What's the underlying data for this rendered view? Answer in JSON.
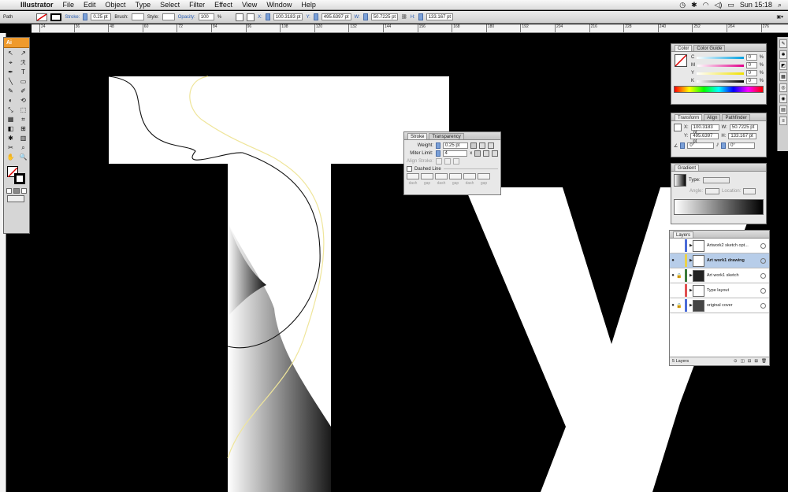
{
  "menubar": {
    "app": "Illustrator",
    "menus": [
      "File",
      "Edit",
      "Object",
      "Type",
      "Select",
      "Filter",
      "Effect",
      "View",
      "Window",
      "Help"
    ],
    "clock": "Sun 15:18"
  },
  "controlbar": {
    "selection_type": "Path",
    "stroke_label": "Stroke:",
    "stroke_value": "0.25 pt",
    "brush_label": "Brush:",
    "style_label": "Style:",
    "opacity_label": "Opacity:",
    "opacity_value": "100",
    "opacity_unit": "%",
    "x_label": "X:",
    "x_value": "100.3183 pt",
    "y_label": "Y:",
    "y_value": "495.6397 pt",
    "w_label": "W:",
    "w_value": "50.7225 pt",
    "h_label": "H:",
    "h_value": "133.167 pt"
  },
  "ruler": [
    "24",
    "36",
    "48",
    "60",
    "72",
    "84",
    "96",
    "108",
    "120",
    "132",
    "144",
    "156",
    "168",
    "180",
    "192",
    "204",
    "216",
    "228",
    "240",
    "252",
    "264",
    "276"
  ],
  "tools_panel": {
    "badge": "Ai",
    "tools": [
      "↖",
      "↗",
      "⌖",
      "ℛ",
      "✒",
      "T",
      "╲",
      "▭",
      "✎",
      "✐",
      "◐",
      "⟲",
      "⤡",
      "⬚",
      "▦",
      "⌗",
      "◧",
      "⊞",
      "✱",
      "▥",
      "✂",
      "⌕",
      "✋",
      "🔍"
    ]
  },
  "color_panel": {
    "tabs": [
      "Color",
      "Color Guide"
    ],
    "channels": [
      {
        "label": "C",
        "value": "0",
        "unit": "%"
      },
      {
        "label": "M",
        "value": "0",
        "unit": "%"
      },
      {
        "label": "Y",
        "value": "0",
        "unit": "%"
      },
      {
        "label": "K",
        "value": "0",
        "unit": "%"
      }
    ]
  },
  "transform_panel": {
    "tabs": [
      "Transform",
      "Align",
      "Pathfinder"
    ],
    "x_label": "X:",
    "x_value": "100.3183 pt",
    "y_label": "Y:",
    "y_value": "495.6397 pt",
    "w_label": "W:",
    "w_value": "50.7225 pt",
    "h_label": "H:",
    "h_value": "133.167 pt",
    "rotate_value": "0°",
    "shear_value": "0°"
  },
  "gradient_panel": {
    "tabs": [
      "Gradient"
    ],
    "type_label": "Type:",
    "angle_label": "Angle:",
    "location_label": "Location:"
  },
  "stroke_panel": {
    "tabs": [
      "Stroke",
      "Transparency"
    ],
    "weight_label": "Weight:",
    "weight_value": "0.25 pt",
    "miter_label": "Miter Limit:",
    "miter_value": "4",
    "miter_unit": "x",
    "align_label": "Align Stroke:",
    "dashed_label": "Dashed Line",
    "dash_labels": [
      "dash",
      "gap",
      "dash",
      "gap",
      "dash",
      "gap"
    ]
  },
  "layers_panel": {
    "tabs": [
      "Layers"
    ],
    "layers": [
      {
        "name": "Artwork2 sketch opt...",
        "color": "#4a6bd8",
        "visible": false,
        "locked": false
      },
      {
        "name": "Art work1 drawing",
        "color": "#ead24a",
        "visible": true,
        "locked": false
      },
      {
        "name": "Art work1 sketch",
        "color": "#3a7a3a",
        "visible": true,
        "locked": true
      },
      {
        "name": "Type layout",
        "color": "#e05050",
        "visible": false,
        "locked": false
      },
      {
        "name": "original cover",
        "color": "#4a6bd8",
        "visible": true,
        "locked": true
      }
    ],
    "footer": "5 Layers"
  },
  "colors": {
    "canvas": "#000000",
    "artboard": "#ffffff",
    "path_yellow": "#efe59a",
    "path_black": "#111111",
    "selected_layer": "#b7cde9"
  }
}
